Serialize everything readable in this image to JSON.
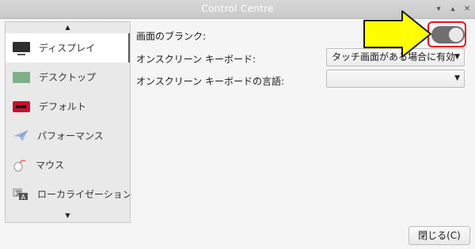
{
  "window": {
    "title": "Control Centre"
  },
  "sidebar": {
    "items": [
      {
        "label": "ディスプレイ",
        "icon": "display-icon"
      },
      {
        "label": "デスクトップ",
        "icon": "desktop-icon"
      },
      {
        "label": "デフォルト",
        "icon": "default-apps-icon"
      },
      {
        "label": "パフォーマンス",
        "icon": "performance-icon"
      },
      {
        "label": "マウス",
        "icon": "mouse-icon"
      },
      {
        "label": "ローカライゼーション",
        "icon": "localization-icon"
      }
    ]
  },
  "settings": {
    "blank_label": "画面のブランク:",
    "blank_enabled": true,
    "osk_label": "オンスクリーン キーボード:",
    "osk_value": "タッチ画面がある場合に有効",
    "osk_lang_label": "オンスクリーン キーボードの言語:",
    "osk_lang_value": ""
  },
  "footer": {
    "close_label": "閉じる(C)"
  },
  "colors": {
    "annotation_arrow": "#ffff00",
    "highlight_box": "#e0162b",
    "toggle_on": "#6f6f6f"
  }
}
